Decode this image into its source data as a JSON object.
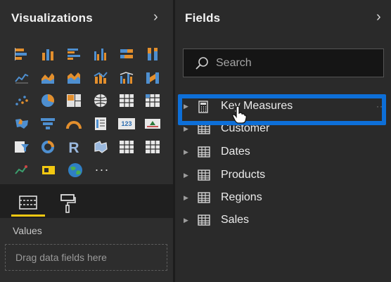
{
  "visualizations": {
    "title": "Visualizations",
    "values_label": "Values",
    "drop_placeholder": "Drag data fields here",
    "more_label": "···",
    "icons": [
      [
        "stacked-bar-chart-icon",
        "stacked-column-chart-icon",
        "clustered-bar-chart-icon",
        "clustered-column-chart-icon",
        "100-stacked-bar-chart-icon",
        "100-stacked-column-chart-icon"
      ],
      [
        "line-chart-icon",
        "area-chart-icon",
        "stacked-area-chart-icon",
        "line-stacked-column-chart-icon",
        "line-clustered-column-chart-icon",
        "ribbon-chart-icon"
      ],
      [
        "scatter-chart-icon",
        "pie-chart-icon",
        "treemap-icon",
        "map-icon",
        "table-icon",
        "matrix-icon"
      ],
      [
        "filled-map-icon",
        "funnel-chart-icon",
        "gauge-icon",
        "multi-row-card-icon",
        "card-icon",
        "kpi-icon"
      ],
      [
        "slicer-icon",
        "donut-chart-icon",
        "r-script-visual-icon",
        "shape-map-icon",
        "custom-table-visual-icon",
        "custom-matrix-visual-icon"
      ],
      [
        "custom-line-visual-icon",
        "custom-slicer-visual-icon",
        "globe-map-icon",
        "more-visuals-icon"
      ]
    ]
  },
  "fields": {
    "title": "Fields",
    "search_placeholder": "Search",
    "items": [
      {
        "label": "Key Measures",
        "icon": "calculator-icon"
      },
      {
        "label": "Customer",
        "icon": "table-icon"
      },
      {
        "label": "Dates",
        "icon": "table-icon"
      },
      {
        "label": "Products",
        "icon": "table-icon"
      },
      {
        "label": "Regions",
        "icon": "table-icon"
      },
      {
        "label": "Sales",
        "icon": "table-icon"
      }
    ]
  },
  "colors": {
    "accent_yellow": "#f2c811",
    "highlight_blue": "#0d6fd8",
    "icon_orange": "#e38f2d",
    "icon_blue": "#4e8fd0"
  }
}
